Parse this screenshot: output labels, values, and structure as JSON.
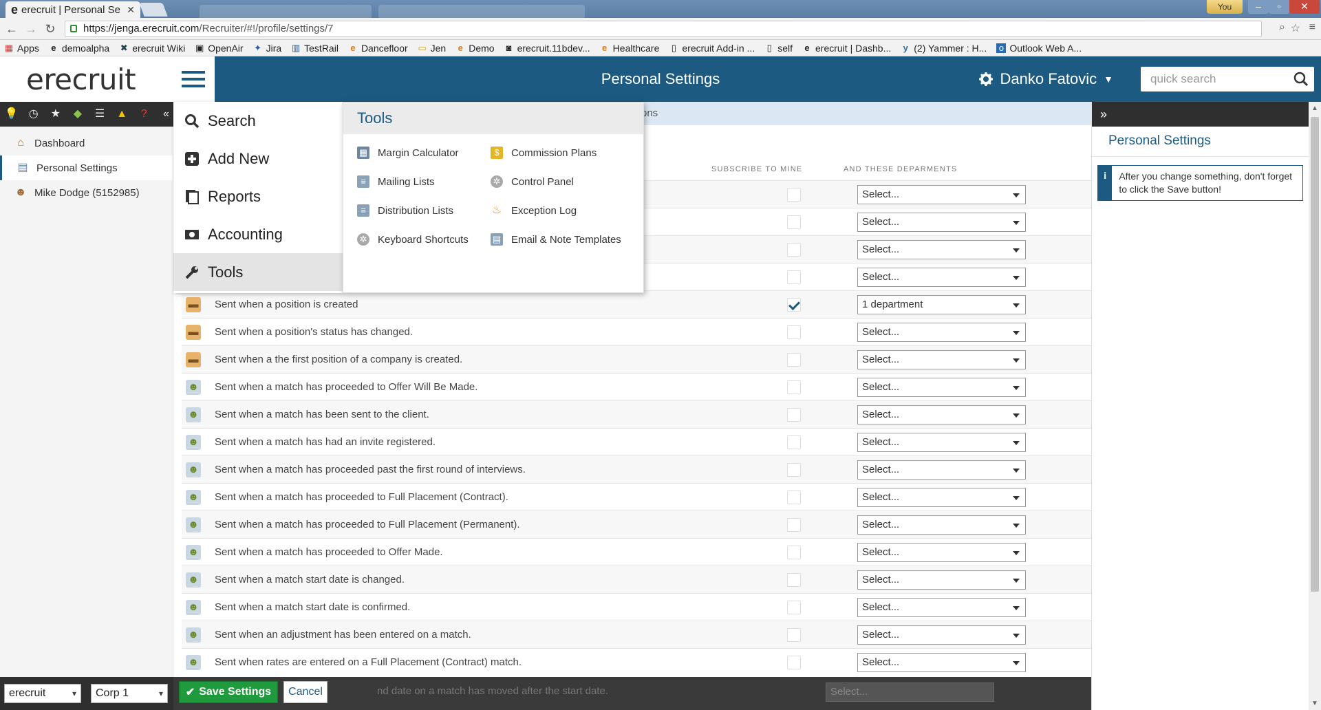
{
  "browser": {
    "tab_title": "erecruit | Personal Se",
    "url_host": "https://jenga.erecruit.com",
    "url_path": "/Recruiter/#!/profile/settings/7",
    "user_badge": "You",
    "bookmarks": [
      {
        "label": "Apps",
        "icon": "apps-grid-icon"
      },
      {
        "label": "demoalpha",
        "icon": "erecruit-e-icon"
      },
      {
        "label": "erecruit Wiki",
        "icon": "wiki-icon"
      },
      {
        "label": "OpenAir",
        "icon": "openair-icon"
      },
      {
        "label": "Jira",
        "icon": "jira-icon"
      },
      {
        "label": "TestRail",
        "icon": "testrail-icon"
      },
      {
        "label": "Dancefloor",
        "icon": "erecruit-e-icon"
      },
      {
        "label": "Jen",
        "icon": "folder-icon"
      },
      {
        "label": "Demo",
        "icon": "erecruit-e-icon"
      },
      {
        "label": "erecruit.11bdev...",
        "icon": "page-icon"
      },
      {
        "label": "Healthcare",
        "icon": "erecruit-e-icon"
      },
      {
        "label": "erecruit Add-in ...",
        "icon": "page-icon"
      },
      {
        "label": "self",
        "icon": "page-icon"
      },
      {
        "label": "erecruit | Dashb...",
        "icon": "erecruit-e-icon"
      },
      {
        "label": "(2) Yammer : H...",
        "icon": "yammer-icon"
      },
      {
        "label": "Outlook Web A...",
        "icon": "outlook-icon"
      }
    ]
  },
  "header": {
    "logo": "erecruit",
    "title": "Personal Settings",
    "user_name": "Danko Fatovic",
    "search_placeholder": "quick search"
  },
  "sidebar": {
    "items": [
      {
        "label": "Dashboard",
        "icon": "home-icon"
      },
      {
        "label": "Personal Settings",
        "icon": "id-card-icon",
        "active": true
      },
      {
        "label": "Mike Dodge (5152985)",
        "icon": "person-icon"
      }
    ],
    "footer_select_1": "erecruit",
    "footer_select_2": "Corp 1"
  },
  "nav_menu": {
    "items": [
      {
        "label": "Search",
        "icon": "search-icon"
      },
      {
        "label": "Add New",
        "icon": "plus-square-icon"
      },
      {
        "label": "Reports",
        "icon": "reports-icon"
      },
      {
        "label": "Accounting",
        "icon": "money-icon"
      },
      {
        "label": "Tools",
        "icon": "wrench-icon",
        "hover": true
      }
    ]
  },
  "tools_panel": {
    "title": "Tools",
    "items": [
      {
        "label": "Margin Calculator",
        "icon": "calculator-icon"
      },
      {
        "label": "Commission Plans",
        "icon": "coins-icon"
      },
      {
        "label": "Mailing Lists",
        "icon": "list-card-icon"
      },
      {
        "label": "Control Panel",
        "icon": "gear-icon"
      },
      {
        "label": "Distribution Lists",
        "icon": "list-card-icon"
      },
      {
        "label": "Exception Log",
        "icon": "flame-icon"
      },
      {
        "label": "Keyboard Shortcuts",
        "icon": "gear-icon"
      },
      {
        "label": "Email & Note Templates",
        "icon": "template-icon"
      }
    ]
  },
  "main": {
    "subtab_fragment": "ons",
    "col_subscribe": "SUBSCRIBE TO MINE",
    "col_departments": "AND THESE DEPARMENTS",
    "rows": [
      {
        "text": "",
        "icon": "blank",
        "checked": false,
        "select": "Select..."
      },
      {
        "text": "",
        "icon": "blank",
        "checked": false,
        "select": "Select..."
      },
      {
        "text": "",
        "icon": "blank",
        "checked": false,
        "select": "Select..."
      },
      {
        "text": "",
        "icon": "blank",
        "checked": false,
        "select": "Select..."
      },
      {
        "text": "Sent when a position is created",
        "icon": "briefcase",
        "checked": true,
        "select": "1 department"
      },
      {
        "text": "Sent when a position's status has changed.",
        "icon": "briefcase",
        "checked": false,
        "select": "Select..."
      },
      {
        "text": "Sent when a the first position of a company is created.",
        "icon": "briefcase",
        "checked": false,
        "select": "Select..."
      },
      {
        "text": "Sent when a match has proceeded to Offer Will Be Made.",
        "icon": "people",
        "checked": false,
        "select": "Select..."
      },
      {
        "text": "Sent when a match has been sent to the client.",
        "icon": "people",
        "checked": false,
        "select": "Select..."
      },
      {
        "text": "Sent when a match has had an invite registered.",
        "icon": "people",
        "checked": false,
        "select": "Select..."
      },
      {
        "text": "Sent when a match has proceeded past the first round of interviews.",
        "icon": "people",
        "checked": false,
        "select": "Select..."
      },
      {
        "text": "Sent when a match has proceeded to Full Placement (Contract).",
        "icon": "people",
        "checked": false,
        "select": "Select..."
      },
      {
        "text": "Sent when a match has proceeded to Full Placement (Permanent).",
        "icon": "people",
        "checked": false,
        "select": "Select..."
      },
      {
        "text": "Sent when a match has proceeded to Offer Made.",
        "icon": "people",
        "checked": false,
        "select": "Select..."
      },
      {
        "text": "Sent when a match start date is changed.",
        "icon": "people",
        "checked": false,
        "select": "Select..."
      },
      {
        "text": "Sent when a match start date is confirmed.",
        "icon": "people",
        "checked": false,
        "select": "Select..."
      },
      {
        "text": "Sent when an adjustment has been entered on a match.",
        "icon": "people",
        "checked": false,
        "select": "Select..."
      },
      {
        "text": "Sent when rates are entered on a Full Placement (Contract) match.",
        "icon": "people",
        "checked": false,
        "select": "Select..."
      }
    ],
    "ghost_row_text": "nd date on a match has moved after the start date.",
    "ghost_select": "Select..."
  },
  "footer": {
    "save_label": "Save Settings",
    "cancel_label": "Cancel"
  },
  "right_panel": {
    "title": "Personal Settings",
    "info": "After you change something, don't forget to click the Save button!"
  },
  "colors": {
    "brand": "#1c5a82",
    "save_green": "#1f9a3c",
    "dark_bar": "#2f2f2f"
  }
}
